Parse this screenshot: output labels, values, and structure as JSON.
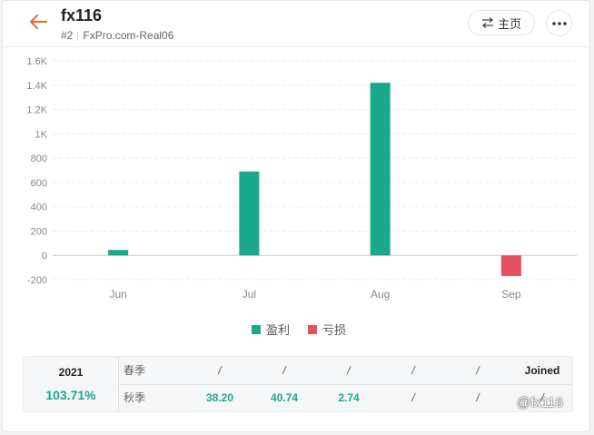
{
  "header": {
    "title": "fx116",
    "rank": "#2",
    "server": "FxPro.com-Real06",
    "home_label": "主页"
  },
  "chart_data": {
    "type": "bar",
    "categories": [
      "Jun",
      "Jul",
      "Aug",
      "Sep"
    ],
    "series": [
      {
        "name": "盈利",
        "color": "#1aa88c",
        "values": [
          45,
          690,
          1420,
          0
        ]
      },
      {
        "name": "亏损",
        "color": "#e5505f",
        "values": [
          0,
          0,
          0,
          -170
        ]
      }
    ],
    "y_ticks": [
      "1.6K",
      "1.4K",
      "1.2K",
      "1K",
      "800",
      "600",
      "400",
      "200",
      "0",
      "-200"
    ],
    "ylim": [
      -200,
      1600
    ],
    "grid": true,
    "legend": "bottom-center"
  },
  "legend": [
    {
      "label": "盈利",
      "color": "#1aa88c"
    },
    {
      "label": "亏损",
      "color": "#e5505f"
    }
  ],
  "table": {
    "year": "2021",
    "total": "103.71%",
    "rows": [
      {
        "label": "春季",
        "cells": [
          "/",
          "/",
          "/",
          "/",
          "/",
          "Joined"
        ]
      },
      {
        "label": "秋季",
        "cells": [
          "38.20",
          "40.74",
          "2.74",
          "/",
          "/",
          "/"
        ]
      }
    ]
  },
  "watermark": "@fx116"
}
